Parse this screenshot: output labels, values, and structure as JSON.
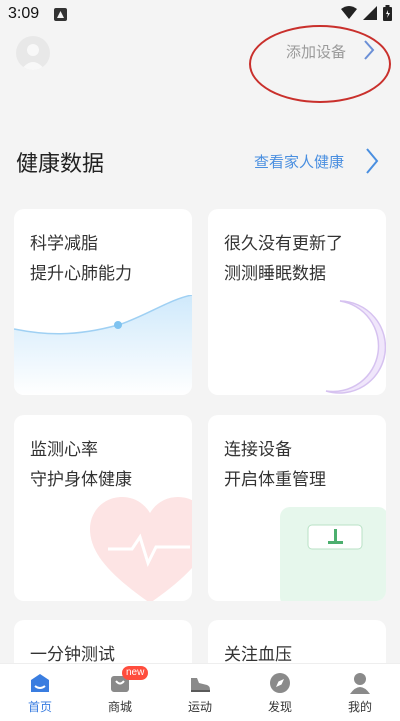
{
  "status_bar": {
    "time": "3:09"
  },
  "header": {
    "add_device_label": "添加设备"
  },
  "section": {
    "title": "健康数据",
    "family_link": "查看家人健康"
  },
  "cards": [
    {
      "line1": "科学减脂",
      "line2": "提升心肺能力",
      "visual": "wave-chart"
    },
    {
      "line1": "很久没有更新了",
      "line2": "测测睡眠数据",
      "visual": "moon"
    },
    {
      "line1": "监测心率",
      "line2": "守护身体健康",
      "visual": "heart"
    },
    {
      "line1": "连接设备",
      "line2": "开启体重管理",
      "visual": "scale"
    },
    {
      "line1": "一分钟测试"
    },
    {
      "line1": "关注血压"
    }
  ],
  "tabs": [
    {
      "label": "首页",
      "icon": "home-icon",
      "active": true
    },
    {
      "label": "商城",
      "icon": "shop-icon",
      "badge": "new"
    },
    {
      "label": "运动",
      "icon": "shoe-icon"
    },
    {
      "label": "发现",
      "icon": "compass-icon"
    },
    {
      "label": "我的",
      "icon": "profile-icon"
    }
  ],
  "colors": {
    "accent": "#3a7de0",
    "link": "#4a8fe0",
    "badge": "#ff4d3d",
    "annotation": "#c9302c"
  }
}
